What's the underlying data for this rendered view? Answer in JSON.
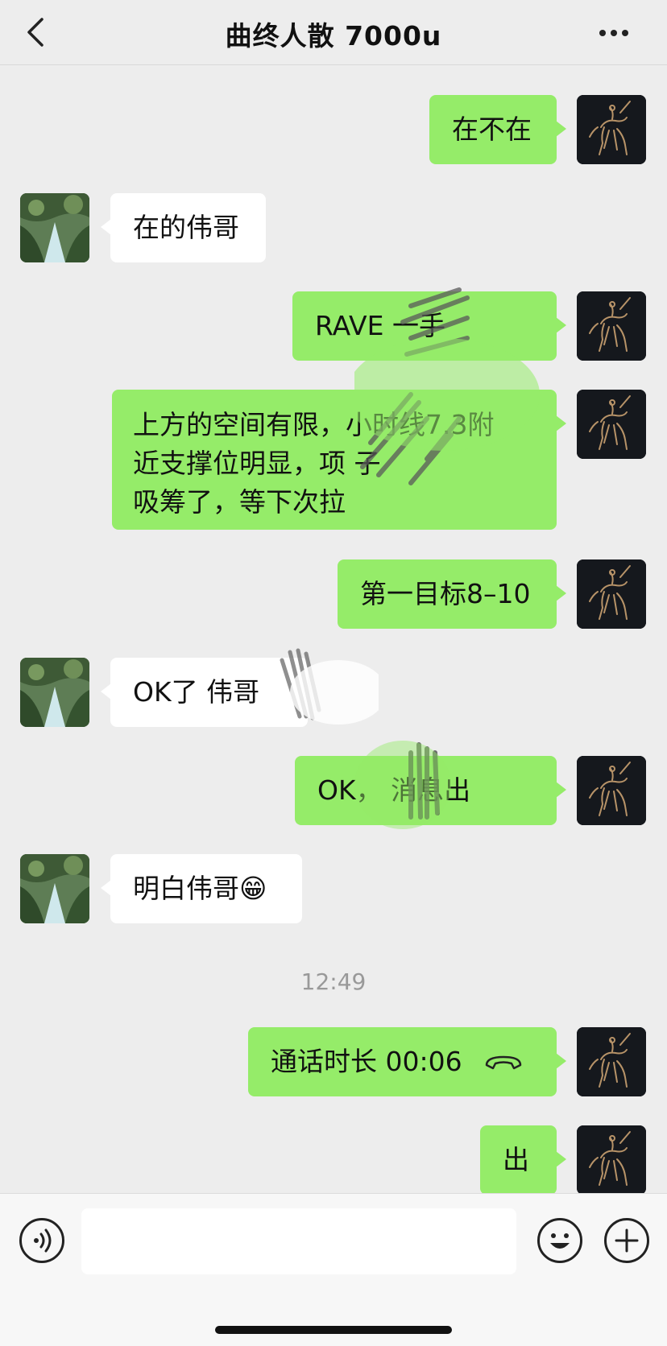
{
  "header": {
    "title": "曲终人散 7000u"
  },
  "messages": [
    {
      "text": "在不在"
    },
    {
      "text": "在的伟哥"
    },
    {
      "text": "RAVE 一手"
    },
    {
      "lines": [
        "上方的空间有限，小时线7.3附",
        "近支撑位明显，项  子",
        "吸筹了，等下次拉"
      ]
    },
    {
      "text": "第一目标8–10"
    },
    {
      "text": "OK了 伟哥"
    },
    {
      "text": "OK，  消息出"
    },
    {
      "text": "明白伟哥😁"
    },
    {
      "text": "通话时长 00:06"
    },
    {
      "text": "出"
    }
  ],
  "timestamp": "12:49",
  "input": {
    "value": ""
  },
  "colors": {
    "self_bubble": "#95ec69",
    "other_bubble": "#ffffff",
    "background": "#ededed"
  },
  "icons": [
    "back-icon",
    "more-icon",
    "hangup-icon",
    "voice-icon",
    "emoji-icon",
    "plus-icon"
  ]
}
